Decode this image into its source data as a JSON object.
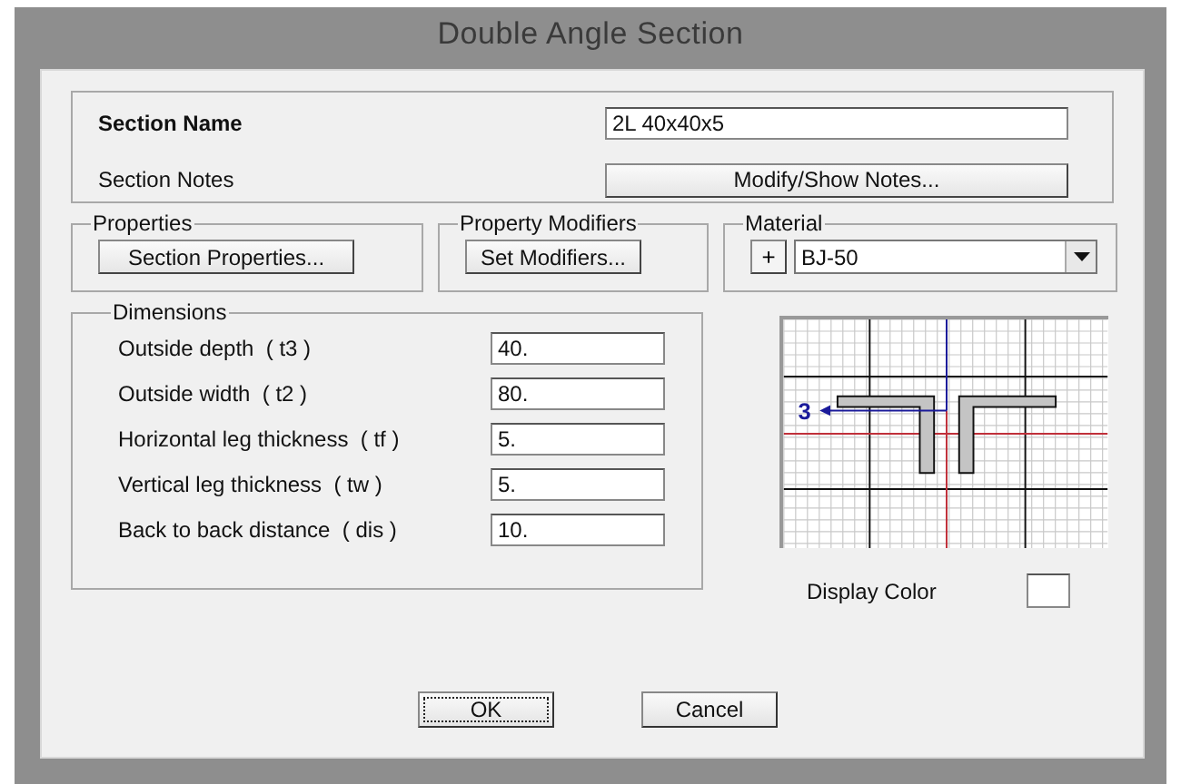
{
  "window": {
    "title": "Double Angle Section"
  },
  "section": {
    "name_label": "Section Name",
    "name_value": "2L 40x40x5",
    "notes_label": "Section Notes",
    "notes_button": "Modify/Show Notes..."
  },
  "properties": {
    "title": "Properties",
    "button": "Section Properties..."
  },
  "property_modifiers": {
    "title": "Property Modifiers",
    "button": "Set Modifiers..."
  },
  "material": {
    "title": "Material",
    "add_button": "+",
    "value": "BJ-50"
  },
  "dimensions": {
    "title": "Dimensions",
    "fields": [
      {
        "label": "Outside depth  ( t3 )",
        "value": "40."
      },
      {
        "label": "Outside width  ( t2 )",
        "value": "80."
      },
      {
        "label": "Horizontal leg thickness  ( tf )",
        "value": "5."
      },
      {
        "label": "Vertical leg thickness  ( tw )",
        "value": "5."
      },
      {
        "label": "Back to back distance  ( dis )",
        "value": "10."
      }
    ]
  },
  "preview": {
    "axis_label": "3"
  },
  "display_color": {
    "label": "Display Color"
  },
  "buttons": [
    {
      "label": "OK",
      "focused": true
    },
    {
      "label": "Cancel",
      "focused": false
    }
  ]
}
